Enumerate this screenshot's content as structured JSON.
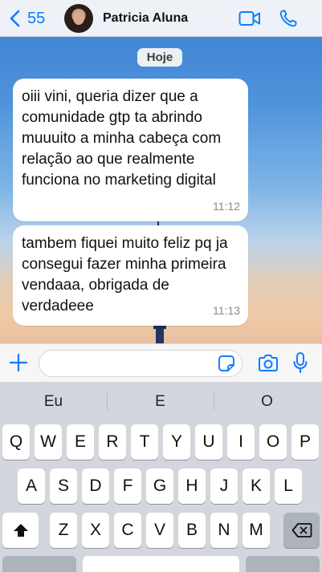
{
  "header": {
    "back_count": "55",
    "contact_name": "Patricia Aluna"
  },
  "chat": {
    "date_label": "Hoje",
    "messages": [
      {
        "text": "oiii vini, queria dizer que a comunidade gtp ta abrindo muuuito a minha cabeça com relação ao que realmente funciona no marketing digital",
        "time": "11:12"
      },
      {
        "text": "tambem fiquei muito feliz pq ja consegui fazer minha primeira vendaaa, obrigada de verdadeee",
        "time": "11:13"
      }
    ]
  },
  "input": {
    "value": ""
  },
  "keyboard": {
    "suggestions": [
      "Eu",
      "E",
      "O"
    ],
    "row1": [
      "Q",
      "W",
      "E",
      "R",
      "T",
      "Y",
      "U",
      "I",
      "O",
      "P"
    ],
    "row2": [
      "A",
      "S",
      "D",
      "F",
      "G",
      "H",
      "J",
      "K",
      "L"
    ],
    "row3": [
      "Z",
      "X",
      "C",
      "V",
      "B",
      "N",
      "M"
    ],
    "shift_icon": "shift-arrow-icon",
    "delete_icon": "backspace-icon"
  },
  "colors": {
    "accent": "#0a7cff",
    "wallpaper_top": "#3b7fd0",
    "wallpaper_bottom": "#f0c9a6",
    "bubble": "#ffffff"
  }
}
